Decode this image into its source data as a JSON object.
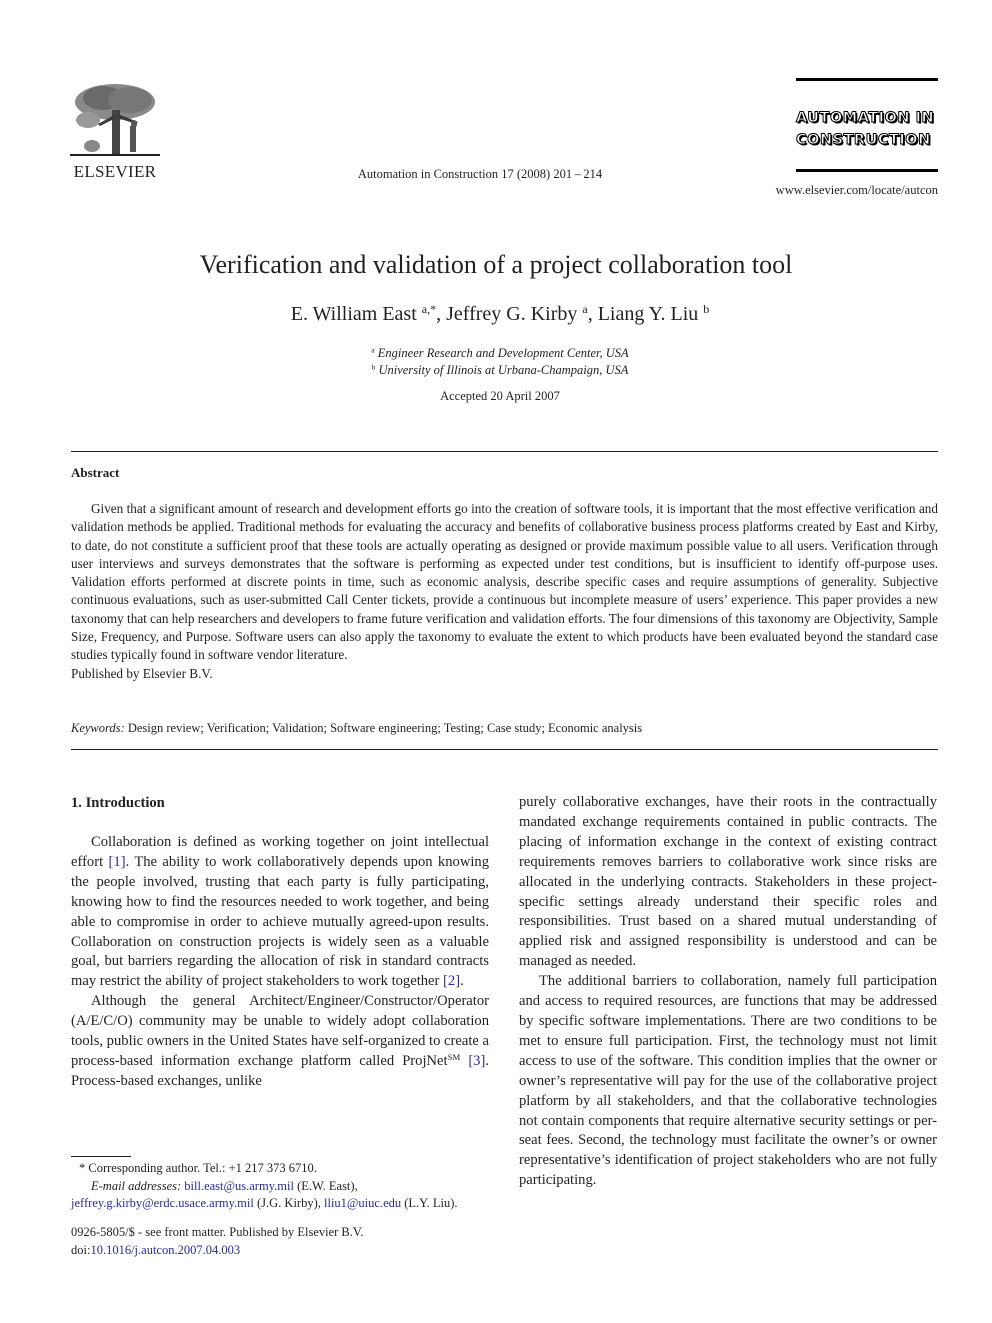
{
  "header": {
    "publisher_wordmark": "ELSEVIER",
    "journal_citation": "Automation in Construction 17 (2008) 201 – 214",
    "journal_brand_line1": "AUTOMATION IN",
    "journal_brand_line2": "CONSTRUCTION",
    "journal_url": "www.elsevier.com/locate/autcon",
    "logo_icon": "elsevier-tree-icon"
  },
  "article": {
    "title": "Verification and validation of a project collaboration tool",
    "authors": [
      {
        "name": "E. William East",
        "sup": "a,*"
      },
      {
        "name": "Jeffrey G. Kirby",
        "sup": "a"
      },
      {
        "name": "Liang Y. Liu",
        "sup": "b"
      }
    ],
    "affiliations": [
      {
        "mark": "a",
        "text": "Engineer Research and Development Center, USA"
      },
      {
        "mark": "b",
        "text": "University of Illinois at Urbana-Champaign, USA"
      }
    ],
    "accepted": "Accepted 20 April 2007"
  },
  "abstract": {
    "heading": "Abstract",
    "text": "Given that a significant amount of research and development efforts go into the creation of software tools, it is important that the most effective verification and validation methods be applied. Traditional methods for evaluating the accuracy and benefits of collaborative business process platforms created by East and Kirby, to date, do not constitute a sufficient proof that these tools are actually operating as designed or provide maximum possible value to all users. Verification through user interviews and surveys demonstrates that the software is performing as expected under test conditions, but is insufficient to identify off-purpose uses. Validation efforts performed at discrete points in time, such as economic analysis, describe specific cases and require assumptions of generality. Subjective continuous evaluations, such as user-submitted Call Center tickets, provide a continuous but incomplete measure of users’ experience. This paper provides a new taxonomy that can help researchers and developers to frame future verification and validation efforts. The four dimensions of this taxonomy are Objectivity, Sample Size, Frequency, and Purpose. Software users can also apply the taxonomy to evaluate the extent to which products have been evaluated beyond the standard case studies typically found in software vendor literature.",
    "publisher_note": "Published by Elsevier B.V."
  },
  "keywords": {
    "label": "Keywords:",
    "text": "Design review; Verification; Validation; Software engineering; Testing; Case study; Economic analysis"
  },
  "body": {
    "section_heading": "1.  Introduction",
    "p1": {
      "a": "Collaboration is defined as working together on joint intellectual effort ",
      "ref1": "[1]",
      "b": ". The ability to work collaboratively depends upon knowing the people involved, trusting that each party is fully participating, knowing how to find the resources needed to work together, and being able to compromise in order to achieve mutually agreed-upon results. Collaboration on construction projects is widely seen as a valuable goal, but barriers regarding the allocation of risk in standard contracts may restrict the ability of project stakeholders to work together ",
      "ref2": "[2]",
      "c": "."
    },
    "p2": {
      "a": "Although the general Architect/Engineer/Constructor/Operator (A/E/C/O) community may be unable to widely adopt collaboration tools, public owners in the United States have self-organized to create a process-based information exchange platform called ProjNet",
      "sup": "SM",
      "ref3": "[3]",
      "b": ". Process-based exchanges, unlike"
    },
    "right_p1": "purely collaborative exchanges, have their roots in the contractually mandated exchange requirements contained in public contracts. The placing of information exchange in the context of existing contract requirements removes barriers to collaborative work since risks are allocated in the underlying contracts. Stakeholders in these project-specific settings already understand their specific roles and responsibilities. Trust based on a shared mutual understanding of applied risk and assigned responsibility is understood and can be managed as needed.",
    "right_p2": "The additional barriers to collaboration, namely full participation and access to required resources, are functions that may be addressed by specific software implementations. There are two conditions to be met to ensure full participation. First, the technology must not limit access to use of the software. This condition implies that the owner or owner’s representative will pay for the use of the collaborative project platform by all stakeholders, and that the collaborative technologies not contain components that require alternative security settings or per-seat fees. Second, the technology must facilitate the owner’s or owner representative’s identification of project stakeholders who are not fully participating."
  },
  "footnotes": {
    "corresponding": "*  Corresponding author. Tel.: +1 217 373 6710.",
    "email_label": "E-mail addresses:",
    "emails": [
      {
        "address": "bill.east@us.army.mil",
        "who": " (E.W. East),"
      },
      {
        "address": "jeffrey.g.kirby@erdc.usace.army.mil",
        "who": " (J.G. Kirby), "
      },
      {
        "address": "lliu1@uiuc.edu",
        "who": " (L.Y. Liu)."
      }
    ],
    "issn_line": "0926-5805/$ - see front matter. Published by Elsevier B.V.",
    "doi_prefix": "doi:",
    "doi": "10.1016/j.autcon.2007.04.003"
  }
}
